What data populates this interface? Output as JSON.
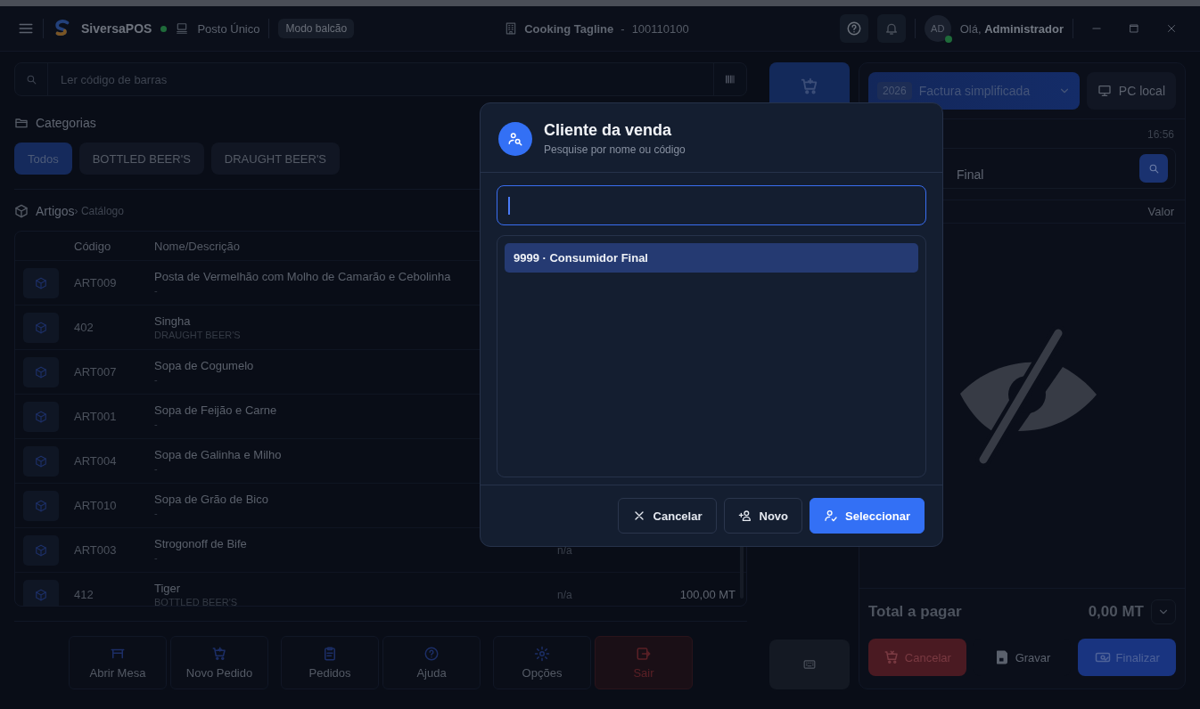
{
  "titlebar": {
    "app_name": "SiversaPOS",
    "online": true,
    "station": "Posto Único",
    "mode_badge": "Modo balcão",
    "company": "Cooking Tagline",
    "separator": "-",
    "company_code": "100110100",
    "avatar_initials": "AD",
    "greeting": "Olá, **Administrador**"
  },
  "barcode": {
    "placeholder": "Ler código de barras"
  },
  "categories": {
    "title": "Categorias",
    "items": [
      {
        "label": "Todos",
        "selected": true
      },
      {
        "label": "BOTTLED BEER'S",
        "selected": false
      },
      {
        "label": "DRAUGHT BEER'S",
        "selected": false
      }
    ]
  },
  "articles": {
    "title": "Artigos",
    "subtitle": "› Catálogo"
  },
  "table": {
    "columns": [
      "Código",
      "Nome/Descrição"
    ],
    "rows": [
      {
        "code": "ART009",
        "name": "Posta de Vermelhão com Molho de Camarão e Cebolinha",
        "description": "-"
      },
      {
        "code": "402",
        "name": "Singha",
        "description": "DRAUGHT BEER'S"
      },
      {
        "code": "ART007",
        "name": "Sopa de Cogumelo",
        "description": "-"
      },
      {
        "code": "ART001",
        "name": "Sopa de Feijão e Carne",
        "description": "-"
      },
      {
        "code": "ART004",
        "name": "Sopa de Galinha e Milho",
        "description": "-"
      },
      {
        "code": "ART010",
        "name": "Sopa de Grão de Bico",
        "description": "-"
      },
      {
        "code": "ART003",
        "name": "Strogonoff de Bife",
        "description": "-",
        "stock": "n/a"
      },
      {
        "code": "412",
        "name": "Tiger",
        "description": "BOTTLED BEER'S",
        "stock": "n/a",
        "price": "100,00 MT"
      }
    ]
  },
  "toolbar": [
    {
      "label": "Abrir Mesa",
      "kind": "normal"
    },
    {
      "label": "Novo Pedido",
      "kind": "normal"
    },
    {
      "label": "Pedidos",
      "kind": "normal"
    },
    {
      "label": "Ajuda",
      "kind": "normal"
    },
    {
      "label": "Opções",
      "kind": "normal"
    },
    {
      "label": "Sair",
      "kind": "danger"
    }
  ],
  "document": {
    "year": "2026",
    "type": "Factura simplificada"
  },
  "printer": "PC local",
  "time": "16:56",
  "customer_field": {
    "value": "Final"
  },
  "lines_header": "Valor",
  "total": {
    "label": "Total a pagar",
    "amount": "0,00 MT"
  },
  "actions": [
    {
      "label": "Cancelar",
      "kind": "danger"
    },
    {
      "label": "Gravar",
      "kind": "plain"
    },
    {
      "label": "Finalizar",
      "kind": "primary"
    }
  ],
  "dialog": {
    "title": "Cliente da venda",
    "subtitle": "Pesquise por nome ou código",
    "results": [
      {
        "label": "9999 · Consumidor Final",
        "selected": true
      }
    ],
    "buttons": [
      {
        "label": "Cancelar",
        "kind": "secondary"
      },
      {
        "label": "Novo",
        "kind": "secondary"
      },
      {
        "label": "Seleccionar",
        "kind": "primary"
      }
    ]
  }
}
